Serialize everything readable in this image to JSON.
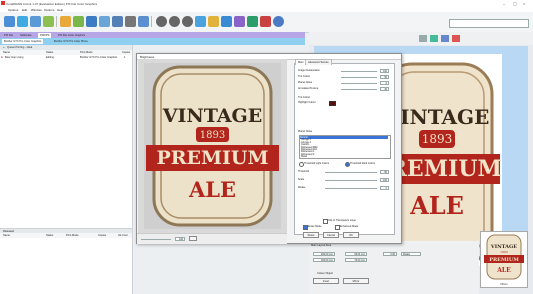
{
  "window": {
    "title": "CorelDRAW Ammit 1.07 (Evaluation Edition) PIX File Color Graphics"
  },
  "menu": [
    "Options",
    "Edit",
    "Window",
    "Options",
    "Help"
  ],
  "search": {
    "placeholder": ""
  },
  "tabs_row1": [
    "PIX File",
    "Sublimate",
    "PDF/PS",
    "PIX File Color Graphics"
  ],
  "tabs_row2": [
    "Brother GTX Pro Color Graphics",
    "Brother GTX Pro Color Photo"
  ],
  "left_panel": {
    "header": "Queue Printing - Ideal",
    "columns": [
      "Name",
      "Status",
      "Print Mode",
      "Copies"
    ],
    "row": {
      "name": "Beer Hop Living",
      "status": "Editing",
      "mode": "Brother GTX Pro Color Graphics",
      "copies": "1"
    },
    "bottom_header": "Released",
    "bottom_columns": [
      "Name",
      "Status",
      "Print Mode",
      "Copies",
      "Ink Cost"
    ]
  },
  "dialog": {
    "title": "Brightness",
    "preview_label": {
      "line1": "VINTAGE",
      "line2": "1893",
      "line3": "PREMIUM",
      "line4": "ALE"
    },
    "zoom_value": "100",
    "tabs": [
      "Main",
      "Advanced Texture"
    ],
    "labels": {
      "image_desaturation": "Image Desaturation",
      "tint_colour": "Tint Colour",
      "planet_noise": "Planet Noise",
      "annotated_texture": "Annotated Texture",
      "tint_colour2": "Tint Colour",
      "highlight_colour": "Highlight Colour",
      "planet_noise_list": "Planet Noise"
    },
    "values": {
      "image_desaturation": "100",
      "tint_colour": "50",
      "planet_noise": "0",
      "annotated_texture": "40"
    },
    "list_items": [
      "Normal",
      "Grunge 1",
      "Grunge 2",
      "Custom",
      "Distressed Mild",
      "Distressed Full",
      "Distressed 1",
      "Distressed 2",
      "Metal"
    ],
    "radio_labels": [
      "Threshold Light Colors",
      "Threshold Dark Colors"
    ],
    "bottom_labels": {
      "threshold": "Threshold",
      "scale": "Scale",
      "rotate": "Rotate"
    },
    "bottom_values": {
      "threshold": "50",
      "scale": "100",
      "rotate": "0"
    },
    "checkboxes": [
      "Clip to Transparent Layer",
      "Erase Mode",
      "Enhanced Mode"
    ],
    "buttons": {
      "cancel": "Cancel",
      "reset": "Reset",
      "ok": "OK"
    }
  },
  "right_panel": {
    "label_text": {
      "line1": "VINTAGE",
      "line2": "1893",
      "line3": "PREMIUM",
      "line4": "ALE"
    },
    "page_label": "Main Layout Area",
    "fields": {
      "w": "200.00 mm",
      "h": "66.04 mm",
      "x": "200.00 mm",
      "y": "70.00 mm",
      "angle": "0.00",
      "rotate": "Rotate"
    },
    "object": {
      "label": "Colour Object",
      "buttons": [
        "Invert",
        "Mirror"
      ]
    },
    "thumb": {
      "line1": "VINTAGE",
      "line2": "1893",
      "line3": "PREMIUM",
      "line4": "ALE",
      "caption": "Main"
    }
  },
  "colors": {
    "tab_purple": "#b6a6e6",
    "tab_blue": "#8fd0f0",
    "canvas_blue": "#b9d8f3",
    "label_red": "#b2251c",
    "label_cream": "#efe3cc"
  }
}
